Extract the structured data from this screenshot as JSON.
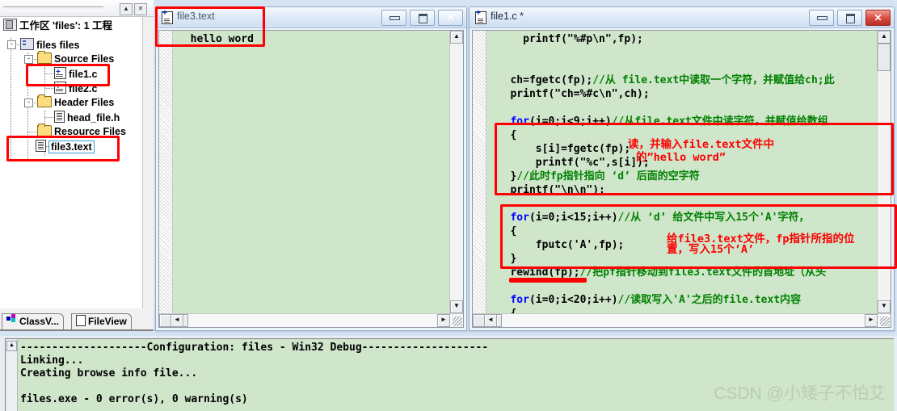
{
  "workspace": {
    "topbar": {
      "up_btn": "▲",
      "close_btn": "✕"
    },
    "root_label": "工作区 'files': 1 工程",
    "nodes": [
      {
        "label": "files files",
        "expander": "-"
      },
      {
        "label": "Source Files",
        "expander": "-"
      },
      {
        "label": "file1.c",
        "expander": ""
      },
      {
        "label": "file2.c",
        "expander": ""
      },
      {
        "label": "Header Files",
        "expander": "-"
      },
      {
        "label": "head_file.h",
        "expander": ""
      },
      {
        "label": "Resource Files",
        "expander": ""
      },
      {
        "label": "file3.text",
        "expander": ""
      }
    ],
    "tabs": [
      {
        "label": "ClassV...",
        "icon": "class-icon",
        "active": true
      },
      {
        "label": "FileView",
        "icon": "document-icon",
        "active": false
      }
    ]
  },
  "file3_window": {
    "title": "file3.text",
    "buttons": {
      "minimize": "minimize-icon",
      "maximize": "maximize-icon",
      "close": "✕"
    },
    "content": "  hello word",
    "scroll": {
      "up": "▲",
      "down": "▼",
      "left": "◄",
      "right": "►"
    }
  },
  "file1_window": {
    "title": "file1.c *",
    "buttons": {
      "minimize": "minimize-icon",
      "maximize": "maximize-icon",
      "close": "✕"
    },
    "scroll": {
      "up": "▲",
      "down": "▼",
      "left": "◄",
      "right": "►"
    },
    "code_lines": [
      {
        "indent": 5,
        "parts": [
          {
            "t": "printf(\"%#p\\n\",fp);",
            "c": ""
          }
        ]
      },
      {
        "indent": 0,
        "parts": [
          {
            "t": "",
            "c": ""
          }
        ]
      },
      {
        "indent": 0,
        "parts": [
          {
            "t": "",
            "c": ""
          }
        ]
      },
      {
        "indent": 3,
        "parts": [
          {
            "t": "ch=fgetc(fp);",
            "c": ""
          },
          {
            "t": "//从 file.text中读取一个字符，并赋值给ch;此",
            "c": "cm"
          }
        ]
      },
      {
        "indent": 3,
        "parts": [
          {
            "t": "printf(\"ch=%#c\\n\",ch);",
            "c": ""
          }
        ]
      },
      {
        "indent": 0,
        "parts": [
          {
            "t": "",
            "c": ""
          }
        ]
      },
      {
        "indent": 3,
        "parts": [
          {
            "t": "for",
            "c": "kw"
          },
          {
            "t": "(i=0;i<9;i++)",
            "c": ""
          },
          {
            "t": "//从file.text文件中读字符，并赋值给数组",
            "c": "cm"
          }
        ]
      },
      {
        "indent": 3,
        "parts": [
          {
            "t": "{",
            "c": ""
          }
        ]
      },
      {
        "indent": 7,
        "parts": [
          {
            "t": "s[i]=fgetc(fp);",
            "c": ""
          }
        ]
      },
      {
        "indent": 7,
        "parts": [
          {
            "t": "printf(\"%c\",s[i]);",
            "c": ""
          }
        ]
      },
      {
        "indent": 3,
        "parts": [
          {
            "t": "}",
            "c": ""
          },
          {
            "t": "//此时fp指针指向 ‘d’ 后面的空字符",
            "c": "cm"
          }
        ]
      },
      {
        "indent": 3,
        "parts": [
          {
            "t": "printf(\"\\n\\n\");",
            "c": ""
          }
        ]
      },
      {
        "indent": 0,
        "parts": [
          {
            "t": "",
            "c": ""
          }
        ]
      },
      {
        "indent": 3,
        "parts": [
          {
            "t": "for",
            "c": "kw"
          },
          {
            "t": "(i=0;i<15;i++)",
            "c": ""
          },
          {
            "t": "//从 ‘d’ 给文件中写入15个'A'字符，",
            "c": "cm"
          }
        ]
      },
      {
        "indent": 3,
        "parts": [
          {
            "t": "{",
            "c": ""
          }
        ]
      },
      {
        "indent": 7,
        "parts": [
          {
            "t": "fputc('A',fp);",
            "c": ""
          }
        ]
      },
      {
        "indent": 3,
        "parts": [
          {
            "t": "}",
            "c": ""
          }
        ]
      },
      {
        "indent": 3,
        "parts": [
          {
            "t": "rewind(fp);",
            "c": ""
          },
          {
            "t": "//把pf指针移动到file3.text文件的首地址（从头",
            "c": "cm"
          }
        ]
      },
      {
        "indent": 0,
        "parts": [
          {
            "t": "",
            "c": ""
          }
        ]
      },
      {
        "indent": 3,
        "parts": [
          {
            "t": "for",
            "c": "kw"
          },
          {
            "t": "(i=0;i<20;i++)",
            "c": ""
          },
          {
            "t": "//读取写入'A'之后的file.text内容",
            "c": "cm"
          }
        ]
      },
      {
        "indent": 3,
        "parts": [
          {
            "t": "{",
            "c": ""
          }
        ]
      }
    ],
    "annotations": [
      {
        "id": "note1_l1",
        "text": "读，并输入file.text文件中"
      },
      {
        "id": "note1_l2",
        "text": "的”hello word”"
      },
      {
        "id": "note2_l1",
        "text": "给file3.text文件，fp指针所指的位"
      },
      {
        "id": "note2_l2",
        "text": "置，写入15个’A’"
      }
    ]
  },
  "output": {
    "lines": [
      "--------------------Configuration: files - Win32 Debug--------------------",
      "Linking...",
      "Creating browse info file...",
      "",
      "files.exe - 0 error(s), 0 warning(s)"
    ],
    "scroll_up": "▲"
  },
  "watermark": "CSDN @小矮子不怕艾",
  "colors": {
    "editor_bg": "#cfe6cb",
    "keyword": "#0000ff",
    "comment": "#008000",
    "annotation_red": "#fb0000",
    "desktop": "#d6e3f2"
  }
}
